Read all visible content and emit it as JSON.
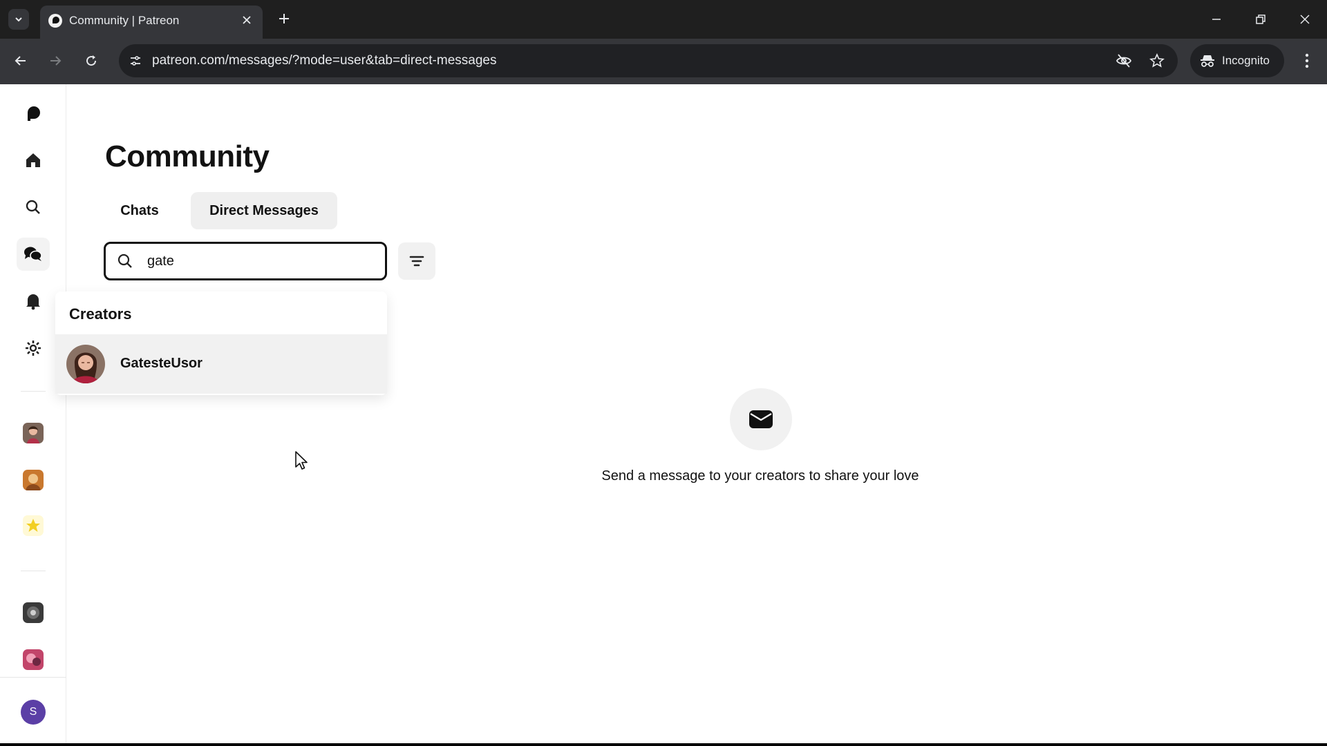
{
  "browser": {
    "tab_title": "Community | Patreon",
    "url": "patreon.com/messages/?mode=user&tab=direct-messages",
    "incognito_label": "Incognito"
  },
  "sidebar": {
    "items": [
      {
        "name": "patreon-logo"
      },
      {
        "name": "home"
      },
      {
        "name": "search"
      },
      {
        "name": "community"
      },
      {
        "name": "notifications"
      },
      {
        "name": "settings"
      }
    ],
    "profile_initial": "S"
  },
  "main": {
    "title": "Community",
    "tabs": [
      {
        "label": "Chats",
        "active": false
      },
      {
        "label": "Direct Messages",
        "active": true
      }
    ],
    "search": {
      "value": "gate",
      "placeholder": ""
    },
    "dropdown": {
      "heading": "Creators",
      "results": [
        {
          "name": "GatesteUsor"
        }
      ]
    },
    "empty_state": {
      "text": "Send a message to your creators to share your love"
    }
  },
  "colors": {
    "chrome_dark": "#202124",
    "chrome_toolbar": "#35363a",
    "active_tab_bg": "#efefef",
    "profile_avatar": "#5b3fa6",
    "text": "#121212"
  }
}
